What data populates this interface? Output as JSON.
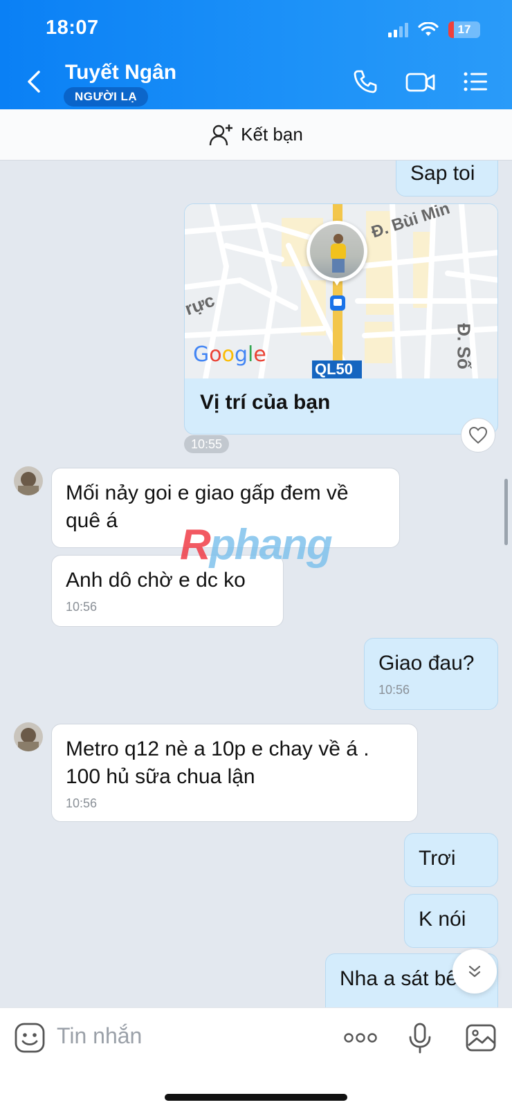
{
  "status_bar": {
    "time": "18:07",
    "battery": "17"
  },
  "header": {
    "name": "Tuyết Ngân",
    "badge": "NGƯỜI LẠ"
  },
  "friend_bar": {
    "label": "Kết bạn"
  },
  "map": {
    "caption": "Vị trí của bạn",
    "time": "10:55",
    "labels": {
      "road1": "Đ. Bùi Min",
      "road2": "rực",
      "road3": "Đ. Số",
      "highway": "QL50",
      "google": "Google"
    }
  },
  "messages": [
    {
      "dir": "out",
      "text": "Sap toi"
    },
    {
      "dir": "in",
      "text": "Mối nảy goi e giao gấp đem về quê á"
    },
    {
      "dir": "in",
      "text": "Anh dô chờ e dc ko",
      "time": "10:56"
    },
    {
      "dir": "out",
      "text": "Giao đau?",
      "time": "10:56"
    },
    {
      "dir": "in",
      "text": "Metro q12 nè a 10p e chay về á . 100 hủ sữa chua lận",
      "time": "10:56"
    },
    {
      "dir": "out",
      "text": "Trơi"
    },
    {
      "dir": "out",
      "text": "K nói"
    },
    {
      "dir": "out",
      "text": "Nha a sát bên"
    }
  ],
  "watermark": {
    "r": "R",
    "rest": "phang"
  },
  "input": {
    "placeholder": "Tin nhắn"
  },
  "colors": {
    "header": "#1a8cf7",
    "outgoing_bubble": "#d4ecfc",
    "incoming_bubble": "#ffffff",
    "background": "#e3e8ef"
  }
}
